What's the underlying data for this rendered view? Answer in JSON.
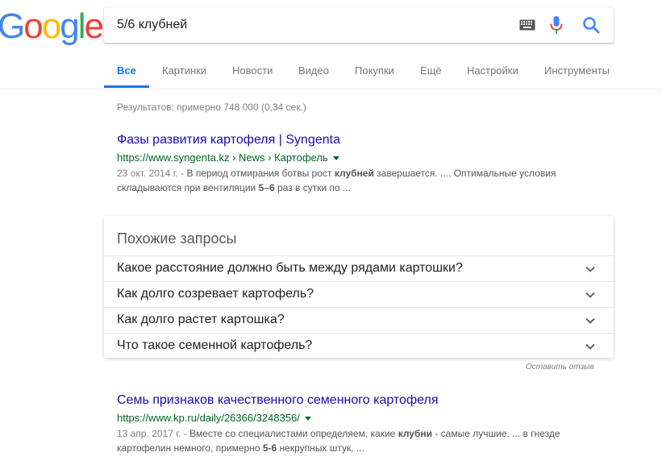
{
  "logo": {
    "letters": [
      "G",
      "o",
      "o",
      "g",
      "l",
      "e"
    ],
    "colors": [
      "#4285F4",
      "#EA4335",
      "#FBBC05",
      "#4285F4",
      "#34A853",
      "#EA4335"
    ]
  },
  "search": {
    "value": "5/6 клубней"
  },
  "tabs": [
    {
      "label": "Все",
      "active": true
    },
    {
      "label": "Картинки"
    },
    {
      "label": "Новости"
    },
    {
      "label": "Видео"
    },
    {
      "label": "Покупки"
    },
    {
      "label": "Ещё"
    },
    {
      "label": "Настройки"
    },
    {
      "label": "Инструменты"
    }
  ],
  "stats": "Результатов: примерно 748 000 (0,34 сек.)",
  "results": [
    {
      "title": "Фазы развития картофеля | Syngenta",
      "url": "https://www.syngenta.kz › News › Картофель",
      "date": "23 окт. 2014 г. -",
      "snippet_line1": [
        {
          "t": " В период отмирания ботвы рост "
        },
        {
          "t": "клубней",
          "b": true
        },
        {
          "t": " завершается. .... Оптимальные условия"
        }
      ],
      "snippet_line2": [
        {
          "t": "складываются при вентиляции "
        },
        {
          "t": "5–6",
          "b": true
        },
        {
          "t": " раз в сутки по ..."
        }
      ]
    },
    {
      "title": "Семь признаков качественного семенного картофеля",
      "url": "https://www.kp.ru/daily/26366/3248356/",
      "date": "13 апр. 2017 г. -",
      "snippet_line1": [
        {
          "t": " Вместе со специалистами определяем, какие "
        },
        {
          "t": "клубни",
          "b": true
        },
        {
          "t": " - самые лучшие. ... в гнезде"
        }
      ],
      "snippet_line2": [
        {
          "t": "картофелин немного, примерно "
        },
        {
          "t": "5-6",
          "b": true
        },
        {
          "t": " некрупных штук, ..."
        }
      ]
    }
  ],
  "related": {
    "title": "Похожие запросы",
    "questions": [
      "Какое расстояние должно быть между рядами картошки?",
      "Как долго созревает картофель?",
      "Как долго растет картошка?",
      "Что такое семенной картофель?"
    ]
  },
  "feedback": "Оставить отзыв",
  "colors": {
    "link": "#1a0dab",
    "url": "#006621",
    "accent": "#1a73e8",
    "mic_blue": "#4285F4",
    "mic_red": "#EA4335"
  },
  "icons": {
    "keyboard": "keyboard-icon",
    "mic": "microphone-icon",
    "search": "search-icon",
    "chevron": "chevron-down-icon"
  }
}
